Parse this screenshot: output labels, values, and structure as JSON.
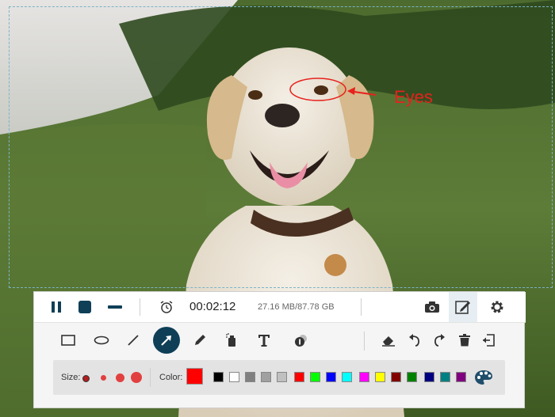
{
  "annotation": {
    "label": "Eyes",
    "color": "#e8211c"
  },
  "recorder": {
    "timer": "00:02:12",
    "storage": "27.16 MB/87.78 GB",
    "accent": "#0e3f57"
  },
  "toolbar_icons": [
    "pause-icon",
    "stop-icon",
    "minimize-icon",
    "alarm-clock-icon",
    "camera-icon",
    "edit-icon",
    "gear-icon"
  ],
  "drawing_tools": [
    "rectangle-icon",
    "ellipse-icon",
    "line-icon",
    "arrow-icon",
    "pencil-icon",
    "spray-icon",
    "text-icon",
    "number-marker-icon",
    "eraser-icon",
    "undo-icon",
    "redo-icon",
    "trash-icon",
    "exit-icon"
  ],
  "palette": {
    "size_label": "Size:",
    "color_label": "Color:",
    "current_color": "#ff0000",
    "colors": [
      "#000000",
      "#ffffff",
      "#808080",
      "#a0a0a0",
      "#c0c0c0",
      "#ff0000",
      "#00ff00",
      "#0000ff",
      "#00ffff",
      "#ff00ff",
      "#ffff00",
      "#800000",
      "#008000",
      "#000080",
      "#008080",
      "#800080"
    ]
  }
}
